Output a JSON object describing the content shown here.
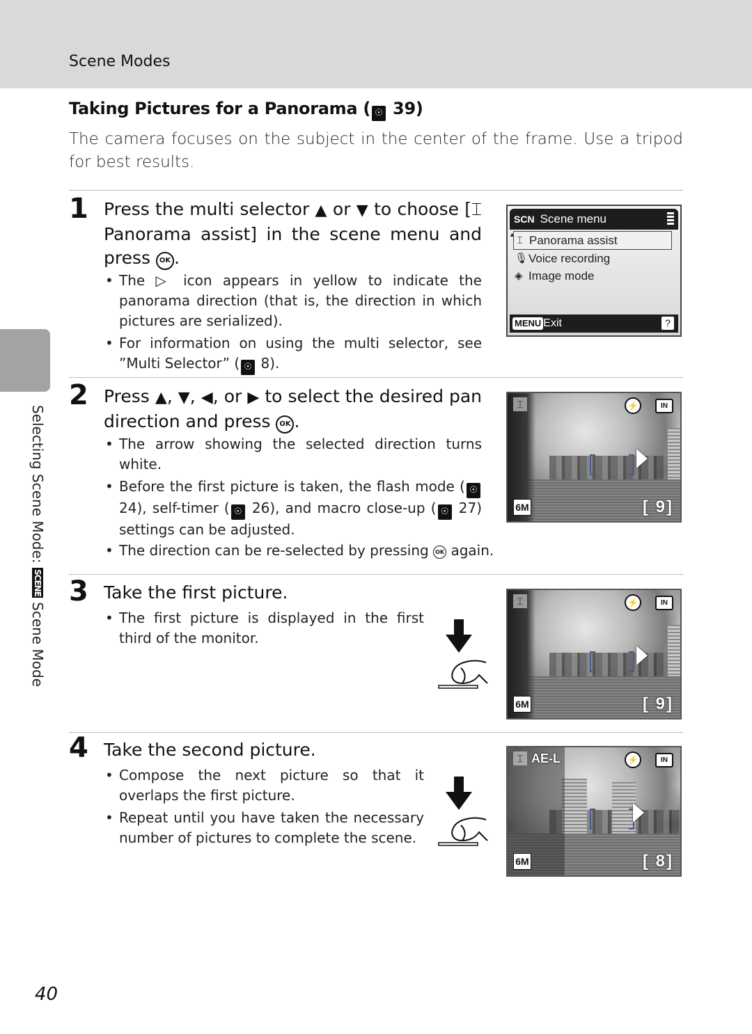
{
  "header": {
    "section": "Scene Modes"
  },
  "title": {
    "text": "Taking Pictures for a Panorama (",
    "ref_page": "39",
    "close": ")"
  },
  "intro": "The camera focuses on the subject in the center of the frame. Use a tripod for best results.",
  "side_tab": {
    "label_before": "Selecting Scene Mode:",
    "badge": "SCENE",
    "label_after": "Scene Mode"
  },
  "steps": [
    {
      "number": "1",
      "title_parts": [
        "Press the multi selector ",
        "▲",
        " or ",
        "▼",
        "  to choose [",
        "⌶",
        " Panorama assist] in the scene menu and press ",
        "OK",
        "."
      ],
      "bullets": [
        {
          "text": "The ▷ icon appears in yellow to indicate the panorama direction (that is, the direction in which pictures are serialized)."
        },
        {
          "pre": "For information on using the multi selector, see ”Multi Selector” (",
          "ref": "8",
          "post": ")."
        }
      ]
    },
    {
      "number": "2",
      "title_parts": [
        "Press ",
        "▲",
        ", ",
        "▼",
        ", ",
        "◀",
        ", or ",
        "▶",
        "  to select the desired pan direction and press ",
        "OK",
        "."
      ],
      "bullets": [
        {
          "text": "The arrow showing the selected direction turns white."
        },
        {
          "p1": "Before the first picture is taken, the flash mode (",
          "r1": "24",
          "p2": "), self-timer (",
          "r2": "26",
          "p3": "), and macro close-up (",
          "r3": "27",
          "p4": ") settings can be adjusted."
        },
        {
          "pre": "The direction can be re-selected by pressing ",
          "ok": "OK",
          "post": " again."
        }
      ]
    },
    {
      "number": "3",
      "title": "Take the first picture.",
      "bullets": [
        {
          "text": "The first picture is displayed in the first third of the monitor."
        }
      ]
    },
    {
      "number": "4",
      "title": "Take the second picture.",
      "bullets": [
        {
          "text": "Compose the next picture so that it overlaps the first picture."
        },
        {
          "text": "Repeat until you have taken the necessary number of pictures to complete the scene."
        }
      ]
    }
  ],
  "scene_menu_screen": {
    "mode_icon": "SCN",
    "title": "Scene menu",
    "items": [
      {
        "icon": "⌶",
        "icon_name": "panorama-icon",
        "label": "Panorama assist",
        "selected": true
      },
      {
        "icon": "🎙",
        "icon_name": "microphone-icon",
        "label": "Voice recording",
        "selected": false
      },
      {
        "icon": "◈",
        "icon_name": "image-mode-icon",
        "label": "Image mode",
        "selected": false
      }
    ],
    "footer_button": "MENU",
    "footer_label": "Exit",
    "help": "?"
  },
  "monitor_screens": [
    {
      "pan": "⌶",
      "flash": "⚡",
      "memory": "IN",
      "image_size": "6M",
      "frames_left": "[  9]",
      "ael": ""
    },
    {
      "pan": "⌶",
      "flash": "⚡",
      "memory": "IN",
      "image_size": "6M",
      "frames_left": "[  9]",
      "ael": ""
    },
    {
      "pan": "⌶",
      "flash": "⚡",
      "memory": "IN",
      "image_size": "6M",
      "frames_left": "[  8]",
      "ael": "AE-L"
    }
  ],
  "ref_icon": "☉",
  "page_number": "40"
}
